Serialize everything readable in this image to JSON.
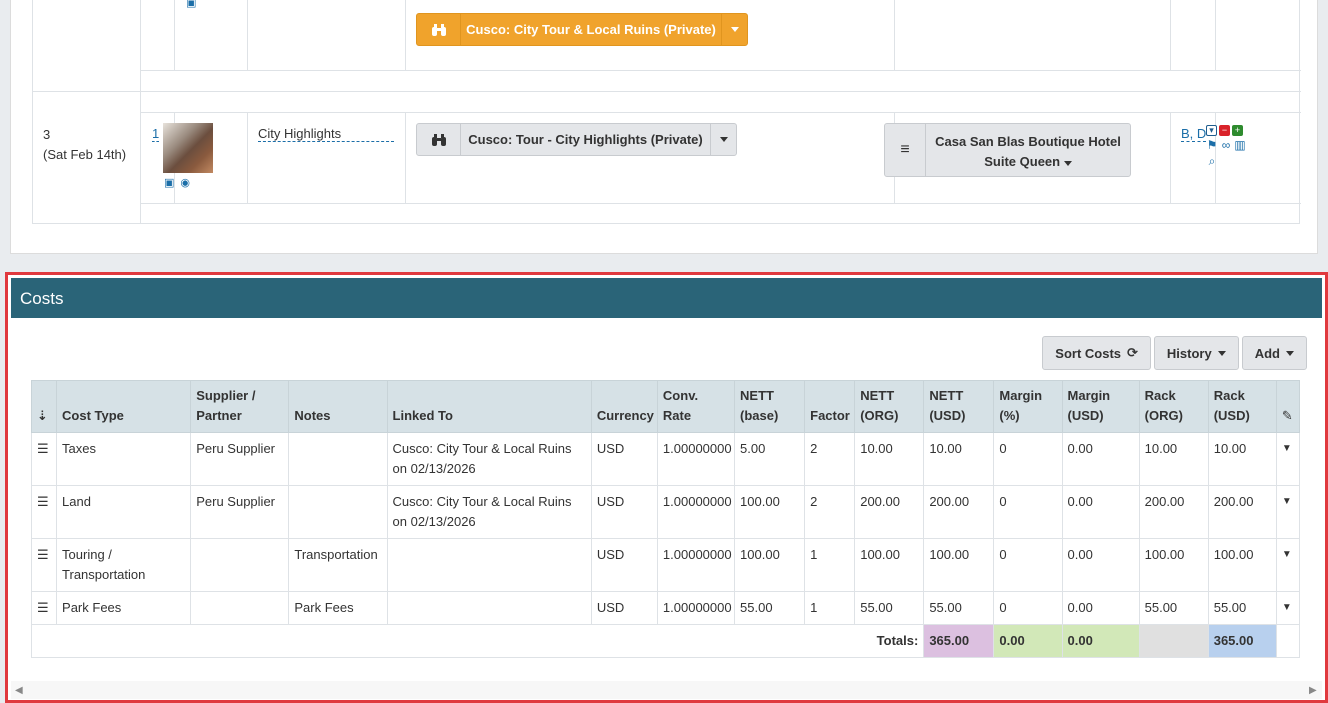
{
  "itinerary": {
    "top_service_label": "Cusco: City Tour & Local Ruins (Private)",
    "day": "3",
    "day_date": "(Sat Feb 14th)",
    "seq_link": "1",
    "activity_name": "City Highlights",
    "service_label": "Cusco: Tour - City Highlights (Private)",
    "hotel_line1": "Casa San Blas Boutique Hotel",
    "hotel_line2": "Suite Queen",
    "guests_link": "B, D",
    "colors": {
      "orange": "#f0a32c",
      "header": "#2a6478",
      "link": "#1b6ea8"
    }
  },
  "costs": {
    "title": "Costs",
    "toolbar": {
      "sort_label": "Sort Costs",
      "history_label": "History",
      "add_label": "Add"
    },
    "columns": [
      "Cost Type",
      "Supplier / Partner",
      "Notes",
      "Linked To",
      "Currency",
      "Conv. Rate",
      "NETT (base)",
      "Factor",
      "NETT (ORG)",
      "NETT (USD)",
      "Margin (%)",
      "Margin (USD)",
      "Rack (ORG)",
      "Rack (USD)"
    ],
    "rows": [
      {
        "cost_type": "Taxes",
        "supplier": "Peru Supplier",
        "notes": "",
        "linked_to": "Cusco: City Tour & Local Ruins on 02/13/2026",
        "currency": "USD",
        "conv_rate": "1.00000000",
        "nett_base": "5.00",
        "factor": "2",
        "nett_org": "10.00",
        "nett_usd": "10.00",
        "margin_pct": "0",
        "margin_usd": "0.00",
        "rack_org": "10.00",
        "rack_usd": "10.00"
      },
      {
        "cost_type": "Land",
        "supplier": "Peru Supplier",
        "notes": "",
        "linked_to": "Cusco: City Tour & Local Ruins on 02/13/2026",
        "currency": "USD",
        "conv_rate": "1.00000000",
        "nett_base": "100.00",
        "factor": "2",
        "nett_org": "200.00",
        "nett_usd": "200.00",
        "margin_pct": "0",
        "margin_usd": "0.00",
        "rack_org": "200.00",
        "rack_usd": "200.00"
      },
      {
        "cost_type": "Touring / Transportation",
        "supplier": "",
        "notes": "Transportation",
        "linked_to": "",
        "currency": "USD",
        "conv_rate": "1.00000000",
        "nett_base": "100.00",
        "factor": "1",
        "nett_org": "100.00",
        "nett_usd": "100.00",
        "margin_pct": "0",
        "margin_usd": "0.00",
        "rack_org": "100.00",
        "rack_usd": "100.00"
      },
      {
        "cost_type": "Park Fees",
        "supplier": "",
        "notes": "Park Fees",
        "linked_to": "",
        "currency": "USD",
        "conv_rate": "1.00000000",
        "nett_base": "55.00",
        "factor": "1",
        "nett_org": "55.00",
        "nett_usd": "55.00",
        "margin_pct": "0",
        "margin_usd": "0.00",
        "rack_org": "55.00",
        "rack_usd": "55.00"
      }
    ],
    "totals": {
      "label": "Totals:",
      "nett_usd": "365.00",
      "margin_pct": "0.00",
      "margin_usd": "0.00",
      "rack_org": "",
      "rack_usd": "365.00",
      "colors": {
        "nett_usd": "#dcc0e0",
        "margin": "#d2e8b8",
        "rack_org": "#e0e0e0",
        "rack_usd": "#b8d0ee"
      }
    }
  }
}
